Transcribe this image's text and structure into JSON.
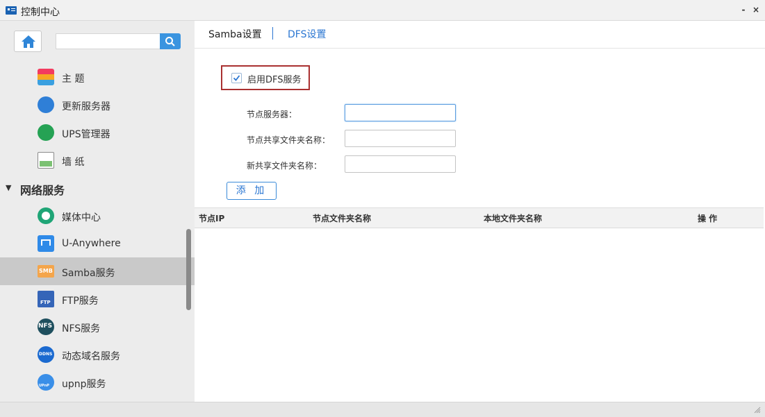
{
  "window": {
    "title": "控制中心",
    "minimize": "-",
    "close": "×"
  },
  "sidebar": {
    "search": {
      "value": "",
      "placeholder": ""
    },
    "items_top": [
      {
        "label": "主 题",
        "icon": "theme-icon"
      },
      {
        "label": "更新服务器",
        "icon": "update-server-icon"
      },
      {
        "label": "UPS管理器",
        "icon": "ups-icon"
      },
      {
        "label": "墙 纸",
        "icon": "wallpaper-icon"
      }
    ],
    "section": {
      "label": "网络服务",
      "expanded": true
    },
    "items_network": [
      {
        "label": "媒体中心",
        "icon": "media-center-icon"
      },
      {
        "label": "U-Anywhere",
        "icon": "u-anywhere-icon"
      },
      {
        "label": "Samba服务",
        "icon": "samba-icon",
        "icon_text": "SMB",
        "selected": true
      },
      {
        "label": "FTP服务",
        "icon": "ftp-icon",
        "icon_text": "FTP"
      },
      {
        "label": "NFS服务",
        "icon": "nfs-icon",
        "icon_text": "NFS"
      },
      {
        "label": "动态域名服务",
        "icon": "ddns-icon",
        "icon_text": "DDNS"
      },
      {
        "label": "upnp服务",
        "icon": "upnp-icon",
        "icon_text": "UPnP"
      }
    ]
  },
  "tabs": [
    {
      "label": "Samba设置",
      "active": false
    },
    {
      "label": "DFS设置",
      "active": true
    }
  ],
  "dfs": {
    "enable_label": "启用DFS服务",
    "enabled": true,
    "node_server_label": "节点服务器：",
    "node_server_value": "",
    "node_share_label": "节点共享文件夹名称：",
    "node_share_value": "",
    "new_share_label": "新共享文件夹名称：",
    "new_share_value": "",
    "add_button": "添 加"
  },
  "table": {
    "columns": [
      "节点IP",
      "节点文件夹名称",
      "本地文件夹名称",
      "操 作"
    ],
    "rows": []
  },
  "colors": {
    "accent": "#2a76d2",
    "highlight_border": "#a93030",
    "selected_bg": "#c9c9c9"
  }
}
